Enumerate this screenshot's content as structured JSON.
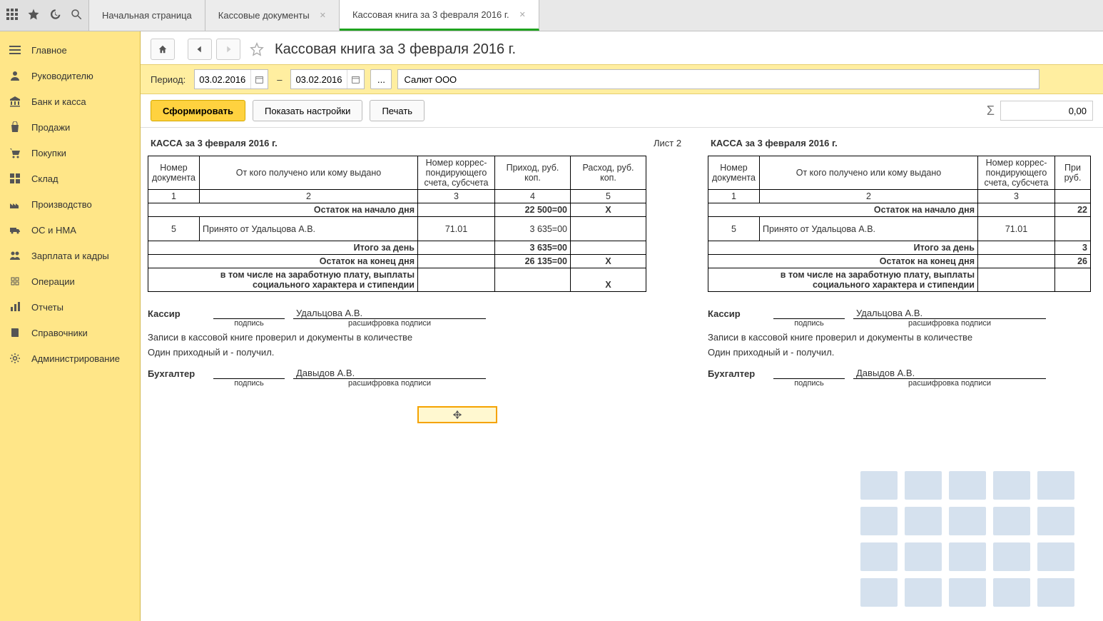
{
  "tabs": {
    "t0": "Начальная страница",
    "t1": "Кассовые документы",
    "t2": "Кассовая книга за 3 февраля 2016 г."
  },
  "sidebar": {
    "items": [
      "Главное",
      "Руководителю",
      "Банк и касса",
      "Продажи",
      "Покупки",
      "Склад",
      "Производство",
      "ОС и НМА",
      "Зарплата и кадры",
      "Операции",
      "Отчеты",
      "Справочники",
      "Администрирование"
    ]
  },
  "header": {
    "title": "Кассовая книга за 3 февраля 2016 г."
  },
  "toolbar": {
    "period_label": "Период:",
    "date_from": "03.02.2016",
    "date_to": "03.02.2016",
    "dash": "–",
    "dots": "...",
    "org": "Салют ООО",
    "generate": "Сформировать",
    "settings": "Показать настройки",
    "print": "Печать",
    "sum": "0,00"
  },
  "report": {
    "left_title": "КАССА за 3 февраля 2016 г.",
    "page_label": "Лист 2",
    "right_title": "КАССА за 3 февраля 2016 г.",
    "headers": {
      "doc_num": "Номер документа",
      "desc": "От кого получено или кому выдано",
      "corr": "Номер коррес-пондирующего счета, субсчета",
      "income": "Приход, руб. коп.",
      "expense": "Расход, руб. коп.",
      "income_short": "При руб."
    },
    "colnums": {
      "c1": "1",
      "c2": "2",
      "c3": "3",
      "c4": "4",
      "c5": "5"
    },
    "rows": {
      "open_label": "Остаток на начало дня",
      "open_income": "22 500=00",
      "open_expense": "X",
      "r1_num": "5",
      "r1_desc": "Принято от Удальцова А.В.",
      "r1_corr": "71.01",
      "r1_income": "3 635=00",
      "total_label": "Итого за день",
      "total_income": "3 635=00",
      "close_label": "Остаток на конец  дня",
      "close_income": "26 135=00",
      "close_expense": "X",
      "payroll_label1": "в том числе на заработную плату, выплаты",
      "payroll_label2": "социального характера и стипендии",
      "payroll_expense": "X",
      "right_open_partial": "22",
      "right_total_partial": "3",
      "right_close_partial": "26"
    },
    "sig": {
      "cashier": "Кассир",
      "cashier_name": "Удальцова А.В.",
      "sign_label": "подпись",
      "decode_label": "расшифровка подписи",
      "note1": "Записи в кассовой книге проверил и документы в количестве",
      "note2": "Один приходный и  -  получил.",
      "accountant": "Бухгалтер",
      "accountant_name": "Давыдов А.В."
    }
  }
}
